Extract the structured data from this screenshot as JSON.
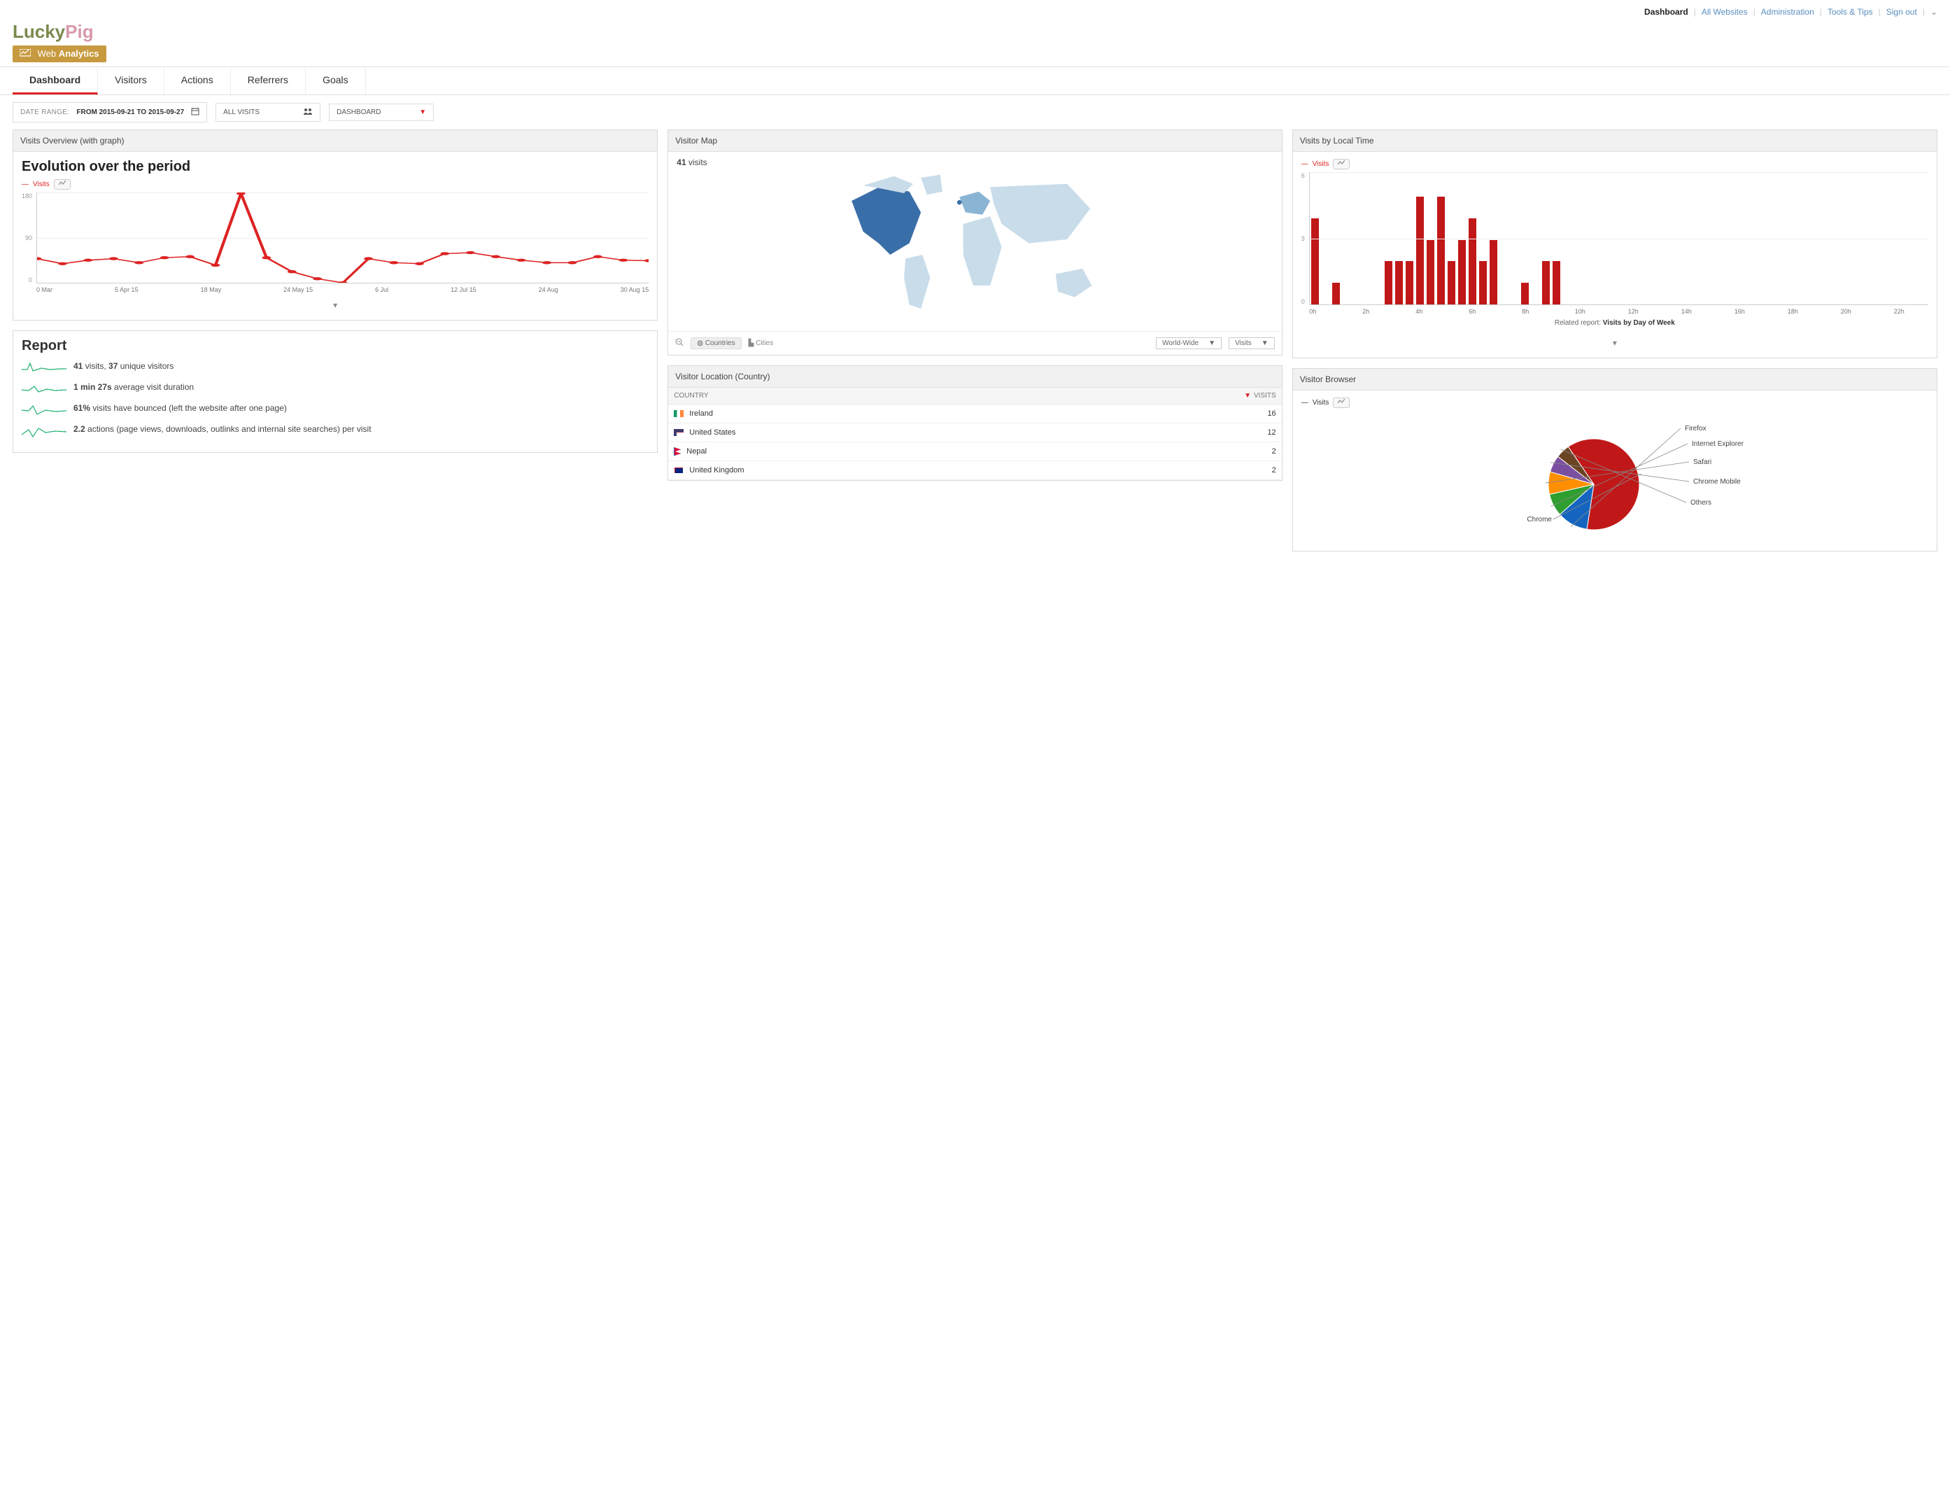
{
  "topnav": {
    "current": "Dashboard",
    "links": [
      "All Websites",
      "Administration",
      "Tools & Tips",
      "Sign out"
    ]
  },
  "brand": {
    "part1": "Lucky",
    "part2": "Pig",
    "badge_prefix": "Web ",
    "badge_strong": "Analytics"
  },
  "tabs": [
    "Dashboard",
    "Visitors",
    "Actions",
    "Referrers",
    "Goals"
  ],
  "controls": {
    "date_range_label": "DATE RANGE:",
    "date_range_value": "FROM 2015-09-21 TO 2015-09-27",
    "segment": "ALL VISITS",
    "view": "DASHBOARD"
  },
  "overview": {
    "card_title": "Visits Overview (with graph)",
    "title": "Evolution over the period",
    "legend": "Visits",
    "y_ticks": [
      "180",
      "90",
      "0"
    ],
    "x_ticks": [
      "0 Mar",
      "5 Apr 15",
      "18 May",
      "24 May 15",
      "6 Jul",
      "12 Jul 15",
      "24 Aug",
      "30 Aug 15"
    ]
  },
  "chart_data": {
    "line": {
      "type": "line",
      "title": "Evolution over the period",
      "ylabel": "Visits",
      "ylim": [
        0,
        180
      ],
      "x": [
        "0 Mar",
        "",
        "",
        "5 Apr 15",
        "",
        "",
        "",
        "18 May",
        "24 May 15",
        "",
        "",
        "6 Jul",
        "12 Jul 15",
        "",
        "",
        "",
        "",
        "",
        "",
        "24 Aug",
        "30 Aug 15",
        "",
        "",
        "",
        ""
      ],
      "values": [
        48,
        38,
        45,
        48,
        40,
        50,
        52,
        35,
        178,
        50,
        22,
        8,
        0,
        48,
        40,
        38,
        58,
        60,
        52,
        45,
        40,
        40,
        52,
        45,
        44
      ]
    },
    "bar": {
      "type": "bar",
      "title": "Visits by Local Time",
      "ylabel": "Visits",
      "ylim": [
        0,
        6
      ],
      "categories": [
        "0h",
        "1h",
        "2h",
        "3h",
        "4h",
        "5h",
        "6h",
        "7h",
        "8h",
        "9h",
        "10h",
        "11h",
        "12h",
        "13h",
        "14h",
        "15h",
        "16h",
        "17h",
        "18h",
        "19h",
        "20h",
        "21h",
        "22h",
        "23h"
      ],
      "values": [
        4,
        0,
        1,
        0,
        0,
        0,
        0,
        2,
        2,
        2,
        5,
        3,
        5,
        2,
        3,
        4,
        2,
        3,
        0,
        0,
        1,
        0,
        2,
        2
      ]
    },
    "pie": {
      "type": "pie",
      "title": "Visitor Browser",
      "series": [
        {
          "name": "Chrome",
          "value": 62,
          "color": "#c01818"
        },
        {
          "name": "Firefox",
          "value": 11,
          "color": "#1565c0"
        },
        {
          "name": "Internet Explorer",
          "value": 8,
          "color": "#2e9e2e"
        },
        {
          "name": "Safari",
          "value": 8,
          "color": "#ff8f00"
        },
        {
          "name": "Chrome Mobile",
          "value": 6,
          "color": "#7b4fa0"
        },
        {
          "name": "Others",
          "value": 5,
          "color": "#6b4423"
        }
      ]
    }
  },
  "report": {
    "title": "Report",
    "rows": [
      {
        "strong": "41",
        "mid": " visits, ",
        "strong2": "37",
        "tail": " unique visitors"
      },
      {
        "strong": "1 min 27s",
        "tail": " average visit duration"
      },
      {
        "strong": "61%",
        "tail": " visits have bounced (left the website after one page)"
      },
      {
        "strong": "2.2",
        "tail": " actions (page views, downloads, outlinks and internal site searches) per visit"
      }
    ]
  },
  "map": {
    "card_title": "Visitor Map",
    "count_num": "41",
    "count_word": " visits",
    "toolbar": {
      "countries": "Countries",
      "cities": "Cities",
      "region_select": "World-Wide",
      "metric_select": "Visits"
    }
  },
  "location_table": {
    "card_title": "Visitor Location (Country)",
    "col_country": "COUNTRY",
    "col_visits": "VISITS",
    "rows": [
      {
        "flag": "ie",
        "country": "Ireland",
        "visits": 16
      },
      {
        "flag": "us",
        "country": "United States",
        "visits": 12
      },
      {
        "flag": "np",
        "country": "Nepal",
        "visits": 2
      },
      {
        "flag": "gb",
        "country": "United Kingdom",
        "visits": 2
      }
    ]
  },
  "localtime": {
    "card_title": "Visits by Local Time",
    "legend": "Visits",
    "related_prefix": "Related report: ",
    "related_link": "Visits by Day of Week"
  },
  "browser": {
    "card_title": "Visitor Browser",
    "legend": "Visits"
  }
}
